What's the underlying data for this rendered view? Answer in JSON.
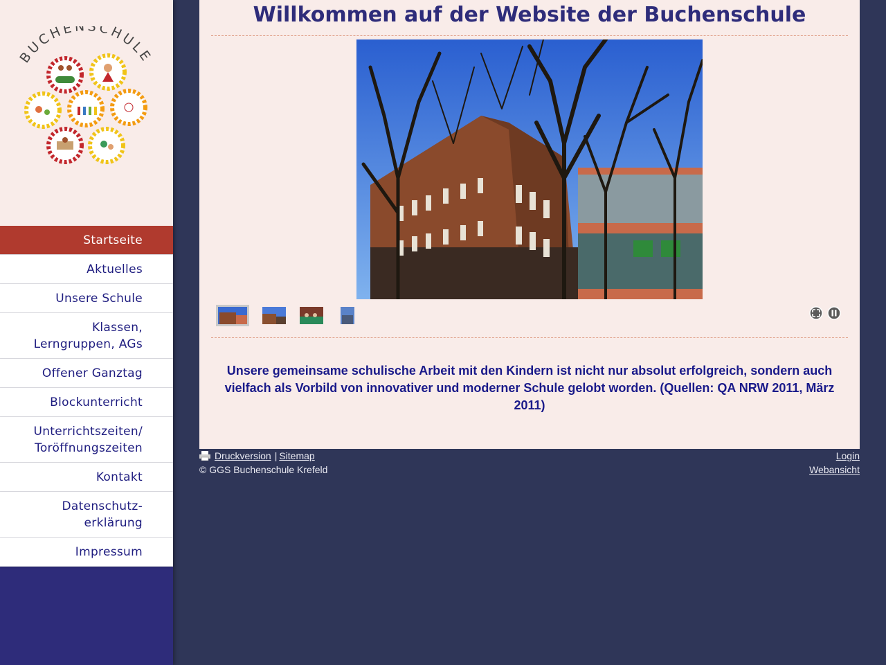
{
  "logo": {
    "text": "BUCHENSCHULE"
  },
  "nav": {
    "items": [
      {
        "label": "Startseite",
        "active": true
      },
      {
        "label": "Aktuelles"
      },
      {
        "label": "Unsere Schule"
      },
      {
        "label": "Klassen,\nLerngruppen, AGs"
      },
      {
        "label": "Offener Ganztag"
      },
      {
        "label": "Blockunterricht"
      },
      {
        "label": "Unterrichtszeiten/\nToröffnungszeiten"
      },
      {
        "label": "Kontakt"
      },
      {
        "label": "Datenschutz-\nerklärung"
      },
      {
        "label": "Impressum"
      }
    ]
  },
  "main": {
    "title": "Willkommen auf der Website der Buchenschule",
    "intro": "Unsere gemeinsame schulische Arbeit mit den Kindern ist nicht nur absolut erfolgreich, sondern auch vielfach als Vorbild von innovativer und moderner Schule gelobt worden. (Quellen: QA NRW 2011, März 2011)",
    "slideshow": {
      "thumbnail_count": 4,
      "selected_index": 0,
      "controls": [
        "fullscreen-icon",
        "pause-icon"
      ]
    }
  },
  "footer": {
    "print_label": "Druckversion",
    "separator": "|",
    "sitemap_label": "Sitemap",
    "copyright": "© GGS Buchenschule Krefeld",
    "login_label": "Login",
    "webview_label": "Webansicht"
  },
  "colors": {
    "page_bg": "#2f3658",
    "content_bg": "#f9ece9",
    "nav_active": "#b03a2e",
    "nav_text": "#1f1d80",
    "title": "#2e2c7a",
    "intro_text": "#1a1a8a"
  }
}
